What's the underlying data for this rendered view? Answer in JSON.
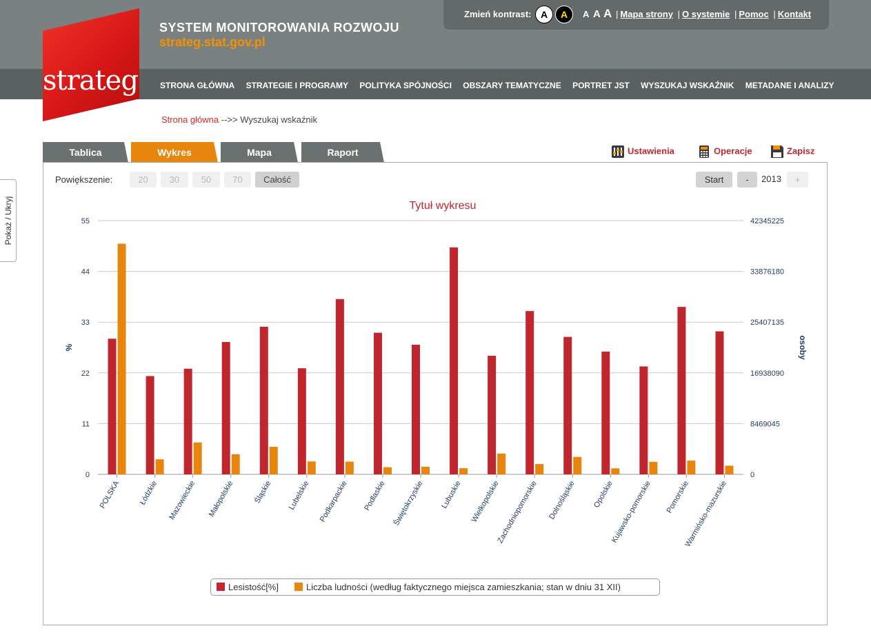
{
  "header": {
    "title": "SYSTEM MONITOROWANIA ROZWOJU",
    "url": "strateg.stat.gov.pl",
    "logo_text": "strateg",
    "contrast_label": "Zmień kontrast:",
    "contrast_options": [
      "A",
      "A"
    ],
    "font_sizes": [
      "A",
      "A",
      "A"
    ],
    "links": [
      "Mapa strony",
      "O systemie",
      "Pomoc",
      "Kontakt"
    ],
    "separator": "|"
  },
  "nav": [
    "STRONA GŁÓWNA",
    "STRATEGIE I PROGRAMY",
    "POLITYKA SPÓJNOŚCI",
    "OBSZARY TEMATYCZNE",
    "PORTRET JST",
    "WYSZUKAJ WSKAŹNIK",
    "METADANE I ANALIZY"
  ],
  "breadcrumb": {
    "home": "Strona główna",
    "sep": " -->> ",
    "current": "Wyszukaj wskaźnik"
  },
  "side_toggle": "Pokaż / Ukryj",
  "tabs": [
    "Tablica",
    "Wykres",
    "Mapa",
    "Raport"
  ],
  "active_tab": "Wykres",
  "tools": {
    "settings": "Ustawienia",
    "operations": "Operacje",
    "save": "Zapisz"
  },
  "zoom": {
    "label": "Powiększenie:",
    "options": [
      "20",
      "30",
      "50",
      "70",
      "Całość"
    ],
    "selected": "Całość"
  },
  "timeline": {
    "start": "Start",
    "minus": "-",
    "year": "2013",
    "plus": "+"
  },
  "colors": {
    "red_series": "#c0262d",
    "orange_series": "#e8850c",
    "accent_orange": "#f39200",
    "tab_active": "#e8850c"
  },
  "chart_data": {
    "type": "bar",
    "title": "Tytuł wykresu",
    "ylabel_left": "%",
    "ylabel_right": "osoby",
    "left_ticks": [
      "0",
      "11",
      "22",
      "33",
      "44",
      "55"
    ],
    "right_ticks": [
      "0",
      "8469045",
      "16938090",
      "25407135",
      "33876180",
      "42345225"
    ],
    "ylim_left": [
      0,
      55
    ],
    "ylim_right": [
      0,
      42345225
    ],
    "grid": true,
    "legend_position": "bottom",
    "categories": [
      "POLSKA",
      "Łódzkie",
      "Mazowieckie",
      "Małopolskie",
      "Śląskie",
      "Lubelskie",
      "Podkarpackie",
      "Podlaskie",
      "Świętokrzyskie",
      "Lubuskie",
      "Wielkopolskie",
      "Zachodniopomorskie",
      "Dolnośląskie",
      "Opolskie",
      "Kujawsko-pomorskie",
      "Pomorskie",
      "Warmińsko-mazurskie"
    ],
    "series": [
      {
        "name": "Lesistość[%]",
        "axis": "left",
        "values": [
          29.4,
          21.3,
          22.9,
          28.7,
          32.0,
          23.0,
          38.0,
          30.7,
          28.1,
          49.2,
          25.7,
          35.4,
          29.8,
          26.6,
          23.4,
          36.3,
          31.0
        ]
      },
      {
        "name": "Liczba ludności (według faktycznego miejsca zamieszkania; stan w dniu 31 XII)",
        "axis": "right",
        "values": [
          38495659,
          2513093,
          5316840,
          3360581,
          4599447,
          2156150,
          2129294,
          1194965,
          1263176,
          1021470,
          3467016,
          1718861,
          2909997,
          1004416,
          2092564,
          2295811,
          1446915
        ]
      }
    ]
  }
}
